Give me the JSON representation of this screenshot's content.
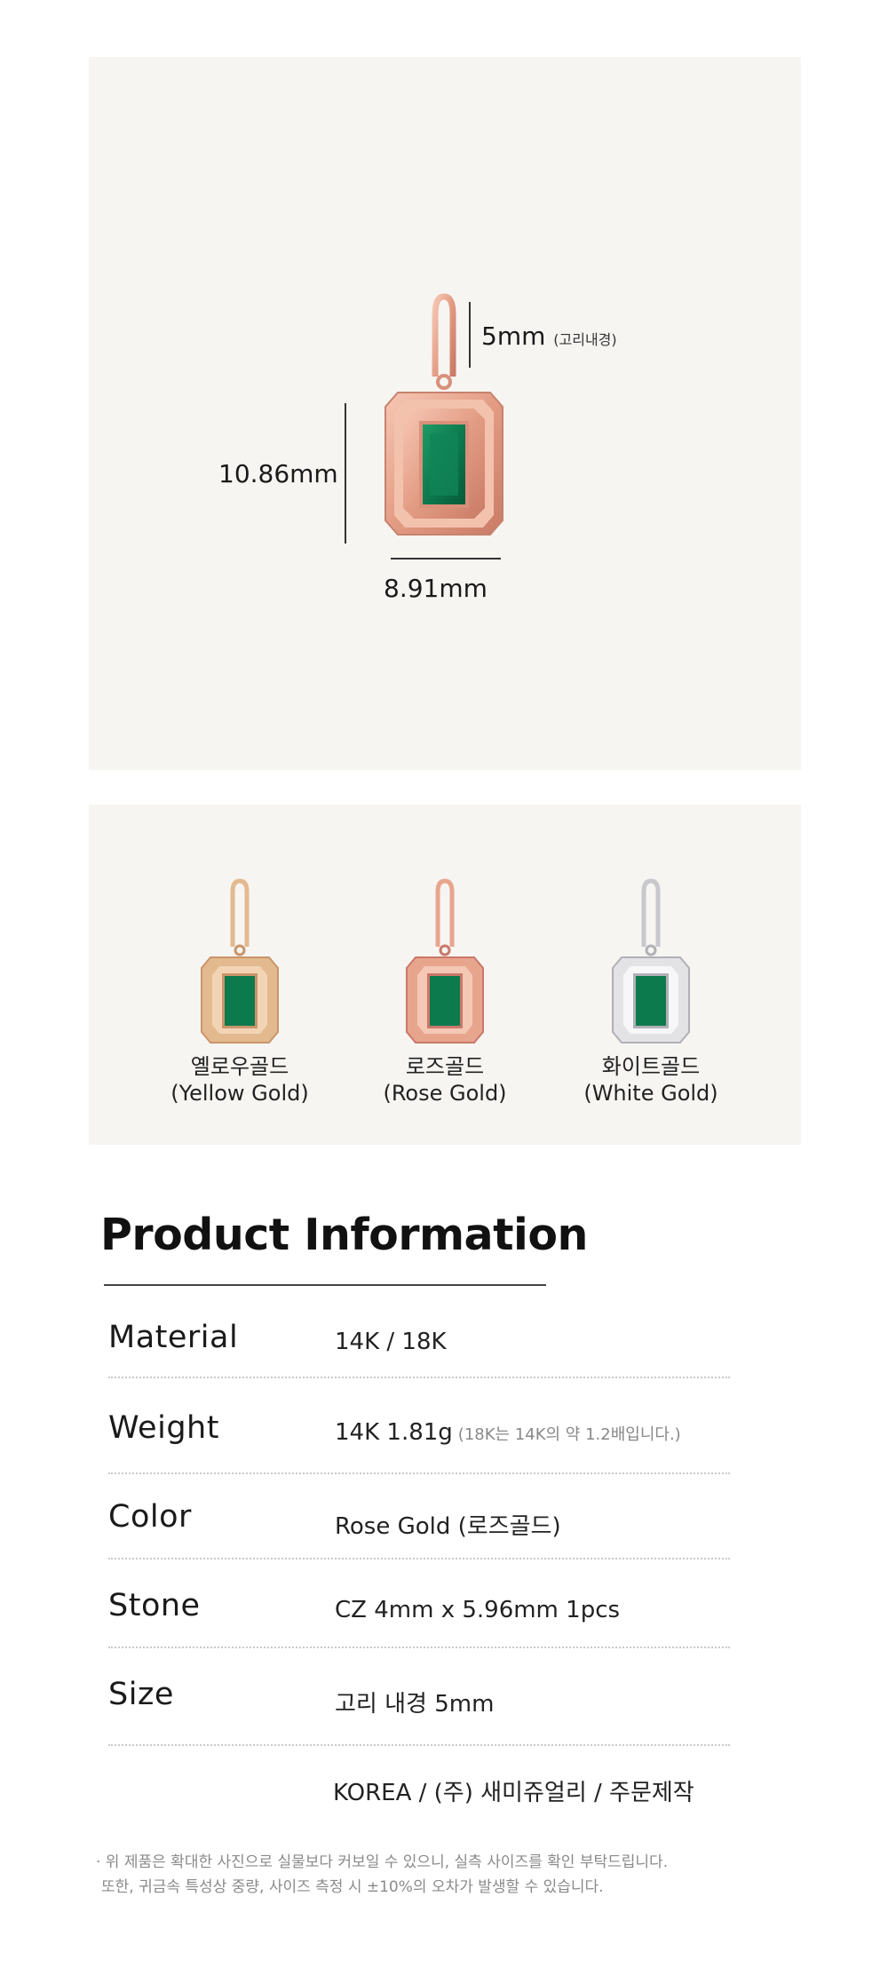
{
  "dimensions": {
    "loop": "5mm",
    "loop_note": "(고리내경)",
    "height": "10.86mm",
    "width": "8.91mm"
  },
  "variants": [
    {
      "name_ko": "옐로우골드",
      "name_en": "(Yellow Gold)",
      "metal": "#e3b98f",
      "metal_dark": "#c9956a"
    },
    {
      "name_ko": "로즈골드",
      "name_en": "(Rose Gold)",
      "metal": "#e8a58d",
      "metal_dark": "#c9786a"
    },
    {
      "name_ko": "화이트골드",
      "name_en": "(White Gold)",
      "metal": "#e3e3e6",
      "metal_dark": "#b0b0b6"
    }
  ],
  "stone_color": "#0d7a4e",
  "info": {
    "title": "Product Information",
    "rows": [
      {
        "label": "Material",
        "value": "14K / 18K",
        "note": ""
      },
      {
        "label": "Weight",
        "value": "14K 1.81g",
        "note": "(18K는 14K의 약 1.2배입니다.)"
      },
      {
        "label": "Color",
        "value": "Rose Gold (로즈골드)",
        "note": ""
      },
      {
        "label": "Stone",
        "value": "CZ 4mm x 5.96mm 1pcs",
        "note": ""
      },
      {
        "label": "Size",
        "value": "고리 내경 5mm",
        "note": ""
      },
      {
        "label": "",
        "value": "KOREA / (주) 새미쥬얼리 / 주문제작",
        "note": ""
      }
    ]
  },
  "footnote": {
    "line1": "· 위 제품은 확대한 사진으로 실물보다 커보일 수 있으니, 실측 사이즈를 확인 부탁드립니다.",
    "line2": "또한, 귀금속 특성상 중량, 사이즈 측정 시 ±10%의 오차가 발생할 수 있습니다."
  }
}
